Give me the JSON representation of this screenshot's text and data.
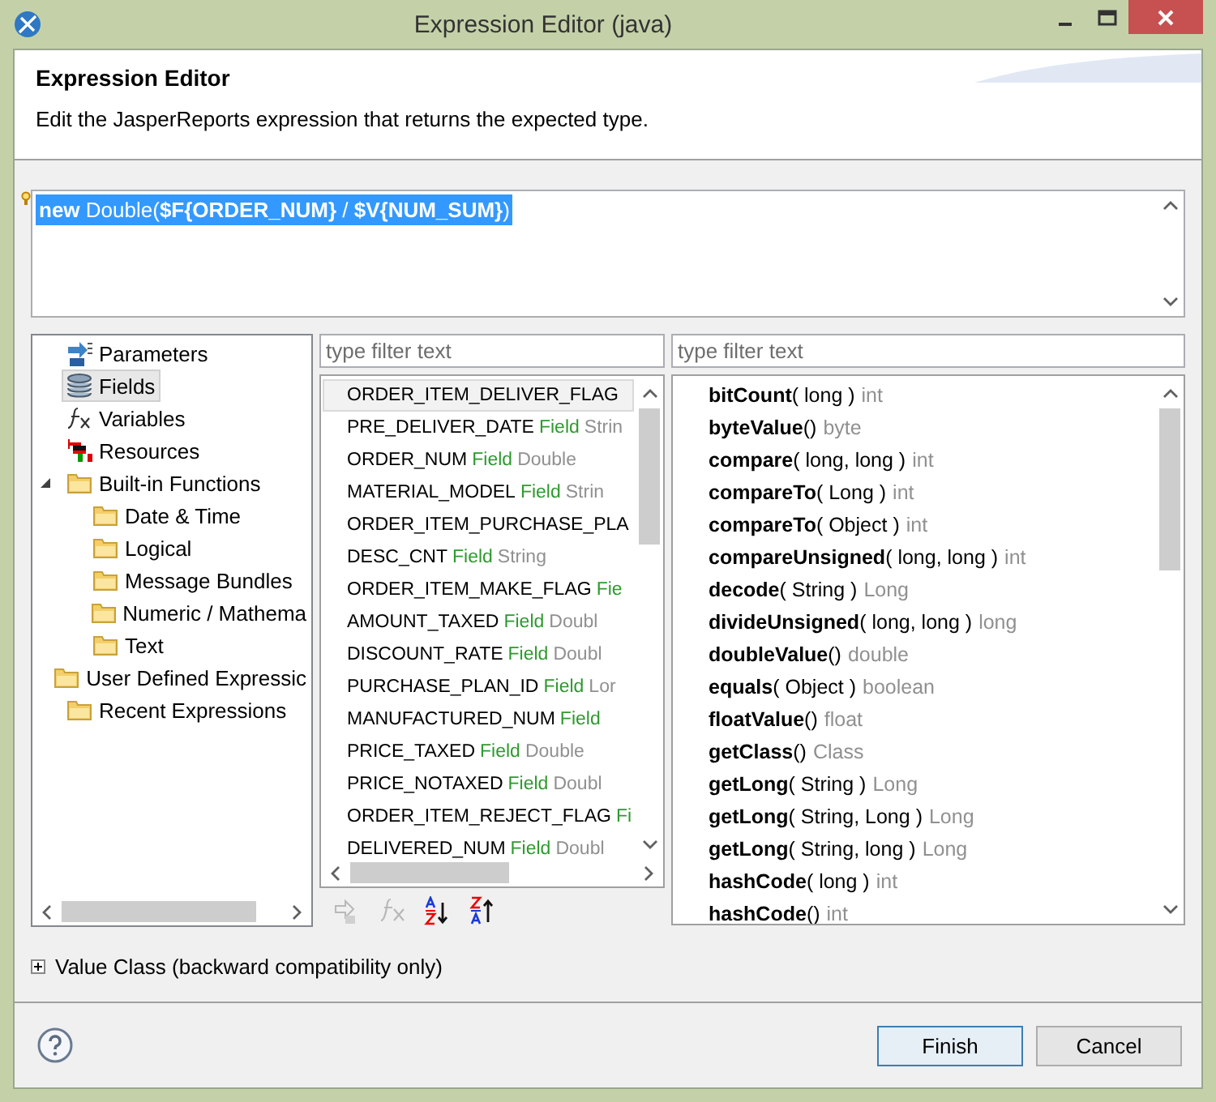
{
  "window": {
    "title": "Expression Editor (java)"
  },
  "header": {
    "title": "Expression Editor",
    "description": "Edit the JasperReports expression that returns the expected type."
  },
  "expression": {
    "text": "**new** Double(**$F{ORDER_NUM}** / **$V{NUM_SUM}**)",
    "selected": true
  },
  "tree": {
    "items": [
      {
        "kind": "parameters",
        "label": "Parameters",
        "selected": false
      },
      {
        "kind": "fields",
        "label": "Fields",
        "selected": true
      },
      {
        "kind": "variables",
        "label": "Variables",
        "selected": false
      },
      {
        "kind": "resources",
        "label": "Resources",
        "selected": false
      },
      {
        "kind": "folder",
        "label": "Built-in Functions",
        "selected": false,
        "expanded": true,
        "children": [
          {
            "kind": "folder",
            "label": "Date & Time",
            "selected": false
          },
          {
            "kind": "folder",
            "label": "Logical",
            "selected": false
          },
          {
            "kind": "folder",
            "label": "Message Bundles",
            "selected": false
          },
          {
            "kind": "folder",
            "label": "Numeric / Mathema",
            "selected": false
          },
          {
            "kind": "folder",
            "label": "Text",
            "selected": false
          }
        ]
      },
      {
        "kind": "folder",
        "label": "User Defined Expressic",
        "selected": false
      },
      {
        "kind": "folder",
        "label": "Recent Expressions",
        "selected": false
      }
    ]
  },
  "fields": {
    "filter": {
      "placeholder": "type filter text"
    },
    "rows": [
      {
        "name": "ORDER_ITEM_DELIVER_FLAG",
        "selected": true
      },
      {
        "name": "PRE_DELIVER_DATE",
        "kind": "Field",
        "type": "Strin",
        "selected": false
      },
      {
        "name": "ORDER_NUM",
        "kind": "Field",
        "type": "Double",
        "selected": false
      },
      {
        "name": "MATERIAL_MODEL",
        "kind": "Field",
        "type": "Strin",
        "selected": false
      },
      {
        "name": "ORDER_ITEM_PURCHASE_PLA",
        "selected": false
      },
      {
        "name": "DESC_CNT",
        "kind": "Field",
        "type": "String",
        "selected": false
      },
      {
        "name": "ORDER_ITEM_MAKE_FLAG",
        "kind": "Fie",
        "selected": false
      },
      {
        "name": "AMOUNT_TAXED",
        "kind": "Field",
        "type": "Doubl",
        "selected": false
      },
      {
        "name": "DISCOUNT_RATE",
        "kind": "Field",
        "type": "Doubl",
        "selected": false
      },
      {
        "name": "PURCHASE_PLAN_ID",
        "kind": "Field",
        "type": "Lor",
        "selected": false
      },
      {
        "name": "MANUFACTURED_NUM",
        "kind": "Field",
        "selected": false
      },
      {
        "name": "PRICE_TAXED",
        "kind": "Field",
        "type": "Double",
        "selected": false
      },
      {
        "name": "PRICE_NOTAXED",
        "kind": "Field",
        "type": "Doubl",
        "selected": false
      },
      {
        "name": "ORDER_ITEM_REJECT_FLAG",
        "kind": "Fi",
        "selected": false
      },
      {
        "name": "DELIVERED_NUM",
        "kind": "Field",
        "type": "Doubl",
        "selected": false
      }
    ]
  },
  "methods": {
    "filter": {
      "placeholder": "type filter text"
    },
    "rows": [
      {
        "name": "bitCount",
        "params": "( long )",
        "returns": "int"
      },
      {
        "name": "byteValue",
        "params": "()",
        "returns": "byte"
      },
      {
        "name": "compare",
        "params": "( long, long )",
        "returns": "int"
      },
      {
        "name": "compareTo",
        "params": "( Long )",
        "returns": "int"
      },
      {
        "name": "compareTo",
        "params": "( Object )",
        "returns": "int"
      },
      {
        "name": "compareUnsigned",
        "params": "( long, long )",
        "returns": "int"
      },
      {
        "name": "decode",
        "params": "( String )",
        "returns": "Long"
      },
      {
        "name": "divideUnsigned",
        "params": "( long, long )",
        "returns": "long"
      },
      {
        "name": "doubleValue",
        "params": "()",
        "returns": "double"
      },
      {
        "name": "equals",
        "params": "( Object )",
        "returns": "boolean"
      },
      {
        "name": "floatValue",
        "params": "()",
        "returns": "float"
      },
      {
        "name": "getClass",
        "params": "()",
        "returns": "Class"
      },
      {
        "name": "getLong",
        "params": "( String )",
        "returns": "Long"
      },
      {
        "name": "getLong",
        "params": "( String, Long )",
        "returns": "Long"
      },
      {
        "name": "getLong",
        "params": "( String, long )",
        "returns": "Long"
      },
      {
        "name": "hashCode",
        "params": "( long )",
        "returns": "int"
      },
      {
        "name": "hashCode",
        "params": "()",
        "returns": "int"
      }
    ]
  },
  "value_class": {
    "label": "Value Class (backward compatibility only)",
    "expanded": false
  },
  "buttons": [
    {
      "label": "Finish",
      "default": true
    },
    {
      "label": "Cancel",
      "default": false
    }
  ]
}
